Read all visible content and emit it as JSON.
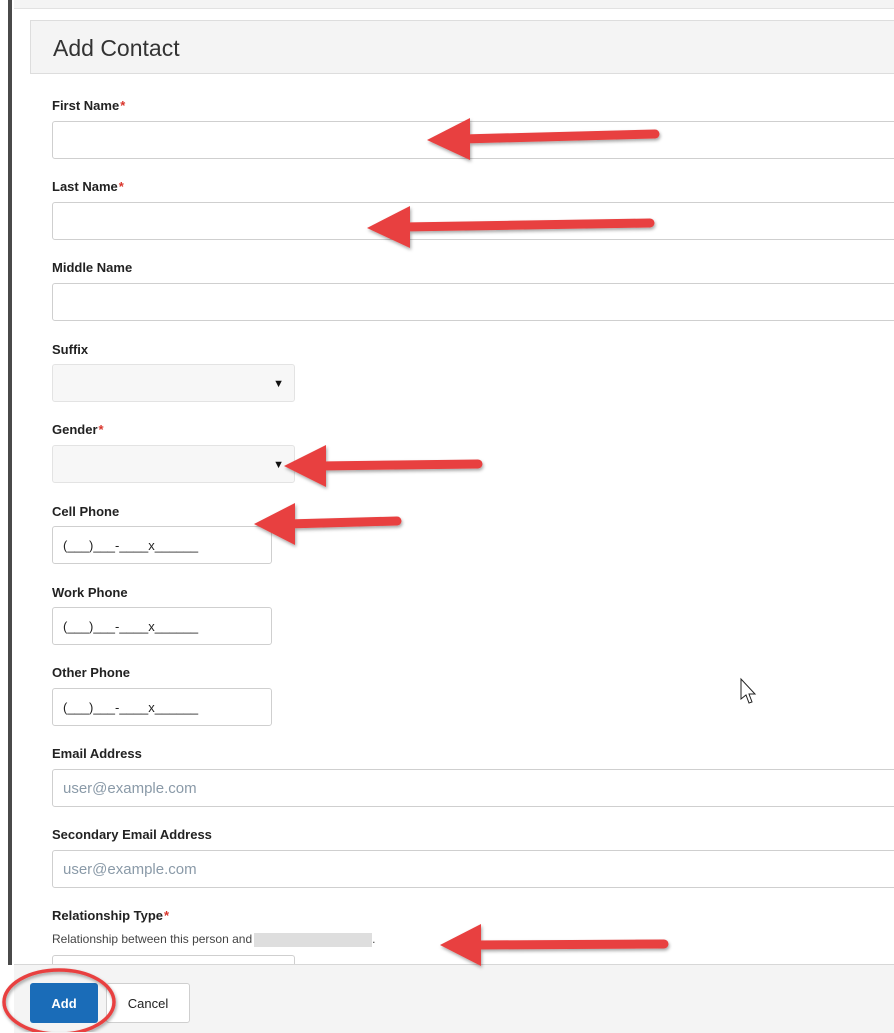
{
  "dialog": {
    "title": "Add Contact"
  },
  "fields": {
    "first_name": {
      "label": "First Name",
      "required": "*",
      "value": ""
    },
    "last_name": {
      "label": "Last Name",
      "required": "*",
      "value": ""
    },
    "middle_name": {
      "label": "Middle Name",
      "value": ""
    },
    "suffix": {
      "label": "Suffix",
      "value": ""
    },
    "gender": {
      "label": "Gender",
      "required": "*",
      "value": ""
    },
    "cell_phone": {
      "label": "Cell Phone",
      "value": "(___)___-____x______"
    },
    "work_phone": {
      "label": "Work Phone",
      "value": "(___)___-____x______"
    },
    "other_phone": {
      "label": "Other Phone",
      "value": "(___)___-____x______"
    },
    "email": {
      "label": "Email Address",
      "placeholder": "user@example.com"
    },
    "secondary_email": {
      "label": "Secondary Email Address",
      "placeholder": "user@example.com"
    },
    "relationship_type": {
      "label": "Relationship Type",
      "required": "*",
      "help_prefix": "Relationship between this person and",
      "help_suffix": "."
    }
  },
  "buttons": {
    "add": "Add",
    "cancel": "Cancel"
  },
  "icons": {
    "dropdown": "caret-down-icon",
    "cursor": "mouse-pointer-icon"
  },
  "colors": {
    "accent": "#1a6cb8",
    "required": "#d9342b",
    "annotation": "#e8403f",
    "placeholder": "#8a9aa8"
  }
}
